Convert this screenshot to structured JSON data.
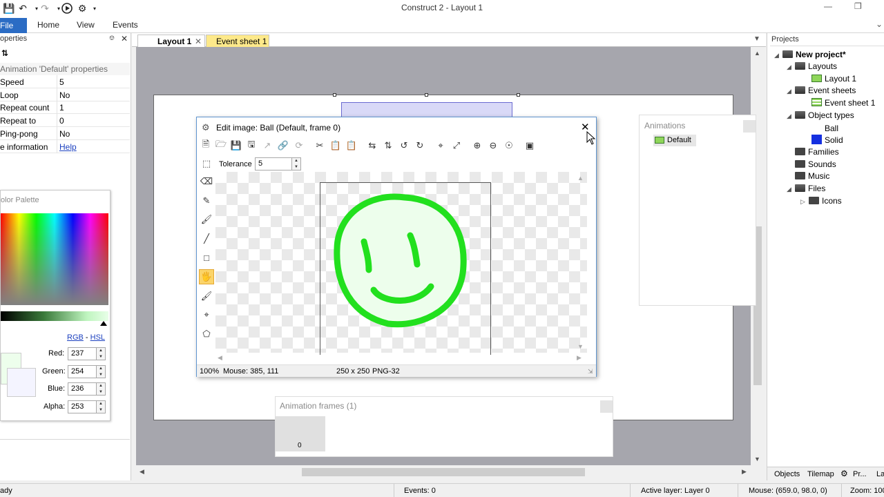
{
  "window": {
    "title": "Construct 2 - Layout 1"
  },
  "ribbon": {
    "file": "File",
    "home": "Home",
    "view": "View",
    "events": "Events"
  },
  "properties": {
    "header": "operties",
    "section": "Animation 'Default' properties",
    "rows": [
      {
        "key": "Speed",
        "value": "5"
      },
      {
        "key": "Loop",
        "value": "No"
      },
      {
        "key": "Repeat count",
        "value": "1"
      },
      {
        "key": "Repeat to",
        "value": "0"
      },
      {
        "key": "Ping-pong",
        "value": "No"
      },
      {
        "key": "e information",
        "value": "Help"
      }
    ]
  },
  "palette": {
    "title": "olor Palette",
    "rgb": "RGB",
    "dash": "-",
    "hsl": "HSL",
    "red_label": "Red:",
    "red": "237",
    "green_label": "Green:",
    "green": "254",
    "blue_label": "Blue:",
    "blue": "236",
    "alpha_label": "Alpha:",
    "alpha": "253",
    "color": "#edfeec"
  },
  "tabs": {
    "layout": "Layout 1",
    "eventsheet": "Event sheet 1"
  },
  "dialog": {
    "title": "Edit image: Ball (Default, frame 0)",
    "tolerance_label": "Tolerance",
    "tolerance": "5",
    "zoom": "100%",
    "mouse": "Mouse: 385, 111",
    "size": "250 x 250",
    "format": "PNG-32",
    "stroke_color": "#22e01e"
  },
  "animations": {
    "title": "Animations",
    "item": "Default"
  },
  "frames": {
    "title": "Animation frames (1)",
    "frame0": "0"
  },
  "projects": {
    "title": "Projects",
    "root": "New project*",
    "layouts": "Layouts",
    "layout1": "Layout 1",
    "eventsheets": "Event sheets",
    "eventsheet1": "Event sheet 1",
    "objecttypes": "Object types",
    "ball": "Ball",
    "solid": "Solid",
    "families": "Families",
    "sounds": "Sounds",
    "music": "Music",
    "files": "Files",
    "icons": "Icons",
    "tab_objects": "Objects",
    "tab_tilemap": "Tilemap",
    "tab_pr": "Pr...",
    "tab_la": "La"
  },
  "status": {
    "ready": "ady",
    "events": "Events: 0",
    "layer": "Active layer: Layer 0",
    "mouse": "Mouse: (659.0, 98.0, 0)",
    "zoom": "Zoom: 100"
  }
}
